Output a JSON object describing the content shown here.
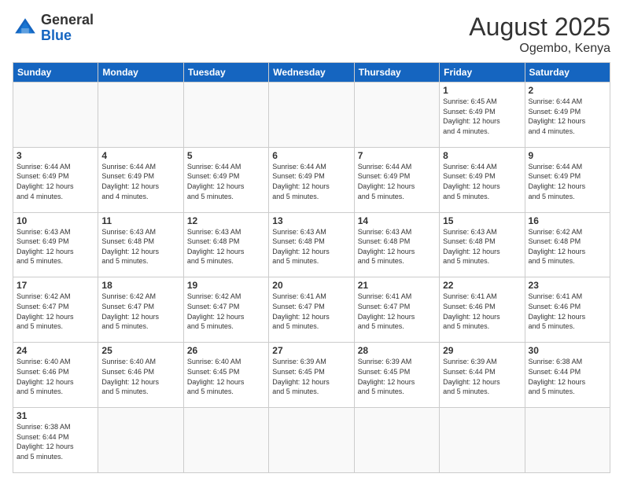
{
  "header": {
    "logo_general": "General",
    "logo_blue": "Blue",
    "month_title": "August 2025",
    "location": "Ogembo, Kenya"
  },
  "weekdays": [
    "Sunday",
    "Monday",
    "Tuesday",
    "Wednesday",
    "Thursday",
    "Friday",
    "Saturday"
  ],
  "weeks": [
    [
      {
        "day": "",
        "info": ""
      },
      {
        "day": "",
        "info": ""
      },
      {
        "day": "",
        "info": ""
      },
      {
        "day": "",
        "info": ""
      },
      {
        "day": "",
        "info": ""
      },
      {
        "day": "1",
        "info": "Sunrise: 6:45 AM\nSunset: 6:49 PM\nDaylight: 12 hours\nand 4 minutes."
      },
      {
        "day": "2",
        "info": "Sunrise: 6:44 AM\nSunset: 6:49 PM\nDaylight: 12 hours\nand 4 minutes."
      }
    ],
    [
      {
        "day": "3",
        "info": "Sunrise: 6:44 AM\nSunset: 6:49 PM\nDaylight: 12 hours\nand 4 minutes."
      },
      {
        "day": "4",
        "info": "Sunrise: 6:44 AM\nSunset: 6:49 PM\nDaylight: 12 hours\nand 4 minutes."
      },
      {
        "day": "5",
        "info": "Sunrise: 6:44 AM\nSunset: 6:49 PM\nDaylight: 12 hours\nand 5 minutes."
      },
      {
        "day": "6",
        "info": "Sunrise: 6:44 AM\nSunset: 6:49 PM\nDaylight: 12 hours\nand 5 minutes."
      },
      {
        "day": "7",
        "info": "Sunrise: 6:44 AM\nSunset: 6:49 PM\nDaylight: 12 hours\nand 5 minutes."
      },
      {
        "day": "8",
        "info": "Sunrise: 6:44 AM\nSunset: 6:49 PM\nDaylight: 12 hours\nand 5 minutes."
      },
      {
        "day": "9",
        "info": "Sunrise: 6:44 AM\nSunset: 6:49 PM\nDaylight: 12 hours\nand 5 minutes."
      }
    ],
    [
      {
        "day": "10",
        "info": "Sunrise: 6:43 AM\nSunset: 6:49 PM\nDaylight: 12 hours\nand 5 minutes."
      },
      {
        "day": "11",
        "info": "Sunrise: 6:43 AM\nSunset: 6:48 PM\nDaylight: 12 hours\nand 5 minutes."
      },
      {
        "day": "12",
        "info": "Sunrise: 6:43 AM\nSunset: 6:48 PM\nDaylight: 12 hours\nand 5 minutes."
      },
      {
        "day": "13",
        "info": "Sunrise: 6:43 AM\nSunset: 6:48 PM\nDaylight: 12 hours\nand 5 minutes."
      },
      {
        "day": "14",
        "info": "Sunrise: 6:43 AM\nSunset: 6:48 PM\nDaylight: 12 hours\nand 5 minutes."
      },
      {
        "day": "15",
        "info": "Sunrise: 6:43 AM\nSunset: 6:48 PM\nDaylight: 12 hours\nand 5 minutes."
      },
      {
        "day": "16",
        "info": "Sunrise: 6:42 AM\nSunset: 6:48 PM\nDaylight: 12 hours\nand 5 minutes."
      }
    ],
    [
      {
        "day": "17",
        "info": "Sunrise: 6:42 AM\nSunset: 6:47 PM\nDaylight: 12 hours\nand 5 minutes."
      },
      {
        "day": "18",
        "info": "Sunrise: 6:42 AM\nSunset: 6:47 PM\nDaylight: 12 hours\nand 5 minutes."
      },
      {
        "day": "19",
        "info": "Sunrise: 6:42 AM\nSunset: 6:47 PM\nDaylight: 12 hours\nand 5 minutes."
      },
      {
        "day": "20",
        "info": "Sunrise: 6:41 AM\nSunset: 6:47 PM\nDaylight: 12 hours\nand 5 minutes."
      },
      {
        "day": "21",
        "info": "Sunrise: 6:41 AM\nSunset: 6:47 PM\nDaylight: 12 hours\nand 5 minutes."
      },
      {
        "day": "22",
        "info": "Sunrise: 6:41 AM\nSunset: 6:46 PM\nDaylight: 12 hours\nand 5 minutes."
      },
      {
        "day": "23",
        "info": "Sunrise: 6:41 AM\nSunset: 6:46 PM\nDaylight: 12 hours\nand 5 minutes."
      }
    ],
    [
      {
        "day": "24",
        "info": "Sunrise: 6:40 AM\nSunset: 6:46 PM\nDaylight: 12 hours\nand 5 minutes."
      },
      {
        "day": "25",
        "info": "Sunrise: 6:40 AM\nSunset: 6:46 PM\nDaylight: 12 hours\nand 5 minutes."
      },
      {
        "day": "26",
        "info": "Sunrise: 6:40 AM\nSunset: 6:45 PM\nDaylight: 12 hours\nand 5 minutes."
      },
      {
        "day": "27",
        "info": "Sunrise: 6:39 AM\nSunset: 6:45 PM\nDaylight: 12 hours\nand 5 minutes."
      },
      {
        "day": "28",
        "info": "Sunrise: 6:39 AM\nSunset: 6:45 PM\nDaylight: 12 hours\nand 5 minutes."
      },
      {
        "day": "29",
        "info": "Sunrise: 6:39 AM\nSunset: 6:44 PM\nDaylight: 12 hours\nand 5 minutes."
      },
      {
        "day": "30",
        "info": "Sunrise: 6:38 AM\nSunset: 6:44 PM\nDaylight: 12 hours\nand 5 minutes."
      }
    ],
    [
      {
        "day": "31",
        "info": "Sunrise: 6:38 AM\nSunset: 6:44 PM\nDaylight: 12 hours\nand 5 minutes."
      },
      {
        "day": "",
        "info": ""
      },
      {
        "day": "",
        "info": ""
      },
      {
        "day": "",
        "info": ""
      },
      {
        "day": "",
        "info": ""
      },
      {
        "day": "",
        "info": ""
      },
      {
        "day": "",
        "info": ""
      }
    ]
  ]
}
